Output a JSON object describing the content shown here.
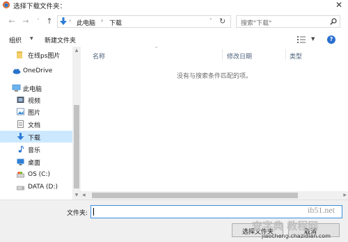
{
  "window": {
    "title": "选择下载文件夹：",
    "close_glyph": "✕"
  },
  "nav": {
    "back_glyph": "←",
    "forward_glyph": "→",
    "dropdown_glyph": "˅",
    "up_glyph": "↑"
  },
  "address": {
    "crumbs": [
      "此电脑",
      "下载"
    ],
    "separator": "›",
    "dropdown_glyph": "˅",
    "refresh_glyph": "↻"
  },
  "search": {
    "placeholder": "搜索\"下载\""
  },
  "toolbar": {
    "organize_label": "组织",
    "organize_arrow": "▼",
    "new_folder_label": "新建文件夹",
    "view_dd_glyph": "▼",
    "help_glyph": "?"
  },
  "sidebar": {
    "items": [
      {
        "label": "在线ps图片",
        "icon": "folder-icon"
      },
      {
        "label": "OneDrive",
        "icon": "cloud-icon"
      },
      {
        "label": "此电脑",
        "icon": "computer-icon"
      },
      {
        "label": "视频",
        "icon": "video-icon"
      },
      {
        "label": "图片",
        "icon": "pictures-icon"
      },
      {
        "label": "文档",
        "icon": "documents-icon"
      },
      {
        "label": "下载",
        "icon": "download-icon",
        "selected": true
      },
      {
        "label": "音乐",
        "icon": "music-icon"
      },
      {
        "label": "桌面",
        "icon": "desktop-icon"
      },
      {
        "label": "OS (C:)",
        "icon": "drive-icon"
      },
      {
        "label": "DATA (D:)",
        "icon": "drive-icon"
      }
    ],
    "scroll_up": "▲",
    "scroll_down": "▼"
  },
  "filelist": {
    "sort_glyph": "^",
    "columns": [
      "名称",
      "修改日期",
      "类型"
    ],
    "empty_message": "没有与搜索条件匹配的项。",
    "scroll_left": "◀",
    "scroll_right": "▶"
  },
  "footer": {
    "folder_label": "文件夹:",
    "folder_value": "",
    "select_label": "选择文件夹",
    "cancel_label": "取消"
  },
  "watermark": {
    "host": "ib51.net",
    "title": "查字典 教程网",
    "url": "jiaocheng.chazidian.com"
  },
  "colors": {
    "accent": "#0078d7",
    "selection": "#cce8ff",
    "footer_bg": "#f0f0f0"
  }
}
